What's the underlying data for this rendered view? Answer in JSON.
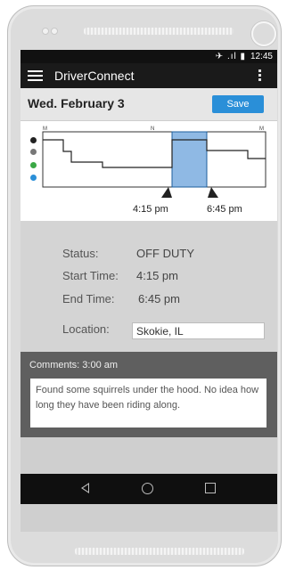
{
  "status_bar": {
    "time": "12:45",
    "icons": "✈ .ıl ▮"
  },
  "app_bar": {
    "title": "DriverConnect"
  },
  "header": {
    "date": "Wed. February 3",
    "save_label": "Save"
  },
  "chart": {
    "top_ticks": [
      "M",
      "N",
      "M"
    ],
    "range_start_label": "4:15 pm",
    "range_end_label": "6:45 pm",
    "legend_colors": [
      "#222222",
      "#777777",
      "#3aa845",
      "#2a8fd8"
    ],
    "selection_color": "#8fb9e4"
  },
  "details": {
    "status_label": "Status:",
    "status_value": "OFF DUTY",
    "start_label": "Start Time:",
    "start_value": "4:15 pm",
    "end_label": "End Time:",
    "end_value": "6:45 pm",
    "location_label": "Location:",
    "location_value": "Skokie, IL"
  },
  "comments": {
    "header": "Comments:  3:00 am",
    "text": "Found some squirrels under the hood. No idea how long they have been riding along."
  }
}
